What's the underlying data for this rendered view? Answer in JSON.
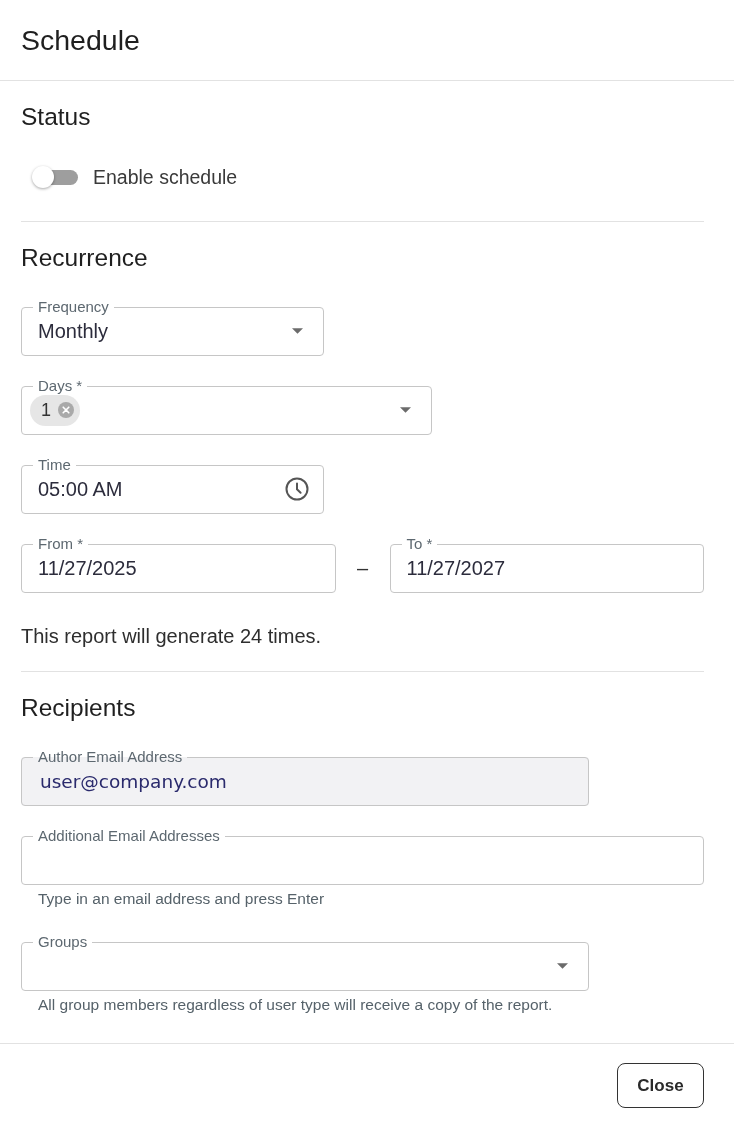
{
  "dialog": {
    "title": "Schedule"
  },
  "status": {
    "heading": "Status",
    "toggle": {
      "label": "Enable schedule",
      "on": false
    }
  },
  "recurrence": {
    "heading": "Recurrence",
    "fields": [
      {
        "kind": "select",
        "label": "Frequency",
        "value": "Monthly"
      },
      {
        "kind": "multi-select",
        "label": "Days *",
        "chips": [
          {
            "label": "1"
          }
        ]
      },
      {
        "kind": "time",
        "label": "Time",
        "value": "05:00 AM"
      },
      {
        "kind": "date-range",
        "from": {
          "label": "From *",
          "value": "11/27/2025"
        },
        "separator": "–",
        "to": {
          "label": "To *",
          "value": "11/27/2027"
        }
      }
    ],
    "summary": "This report will generate 24 times."
  },
  "recipients": {
    "heading": "Recipients",
    "fields": [
      {
        "kind": "email",
        "label": "Author Email Address",
        "value": "user@company.com",
        "disabled": true
      },
      {
        "kind": "email",
        "label": "Additional Email Addresses",
        "helper": "Type in an email address and press Enter",
        "disabled": false
      },
      {
        "kind": "select",
        "label": "Groups",
        "helper": "All group members regardless of user type will receive a copy of the report.",
        "disabled": false
      }
    ]
  },
  "footer": {
    "close_button": {
      "label": "Close"
    }
  }
}
